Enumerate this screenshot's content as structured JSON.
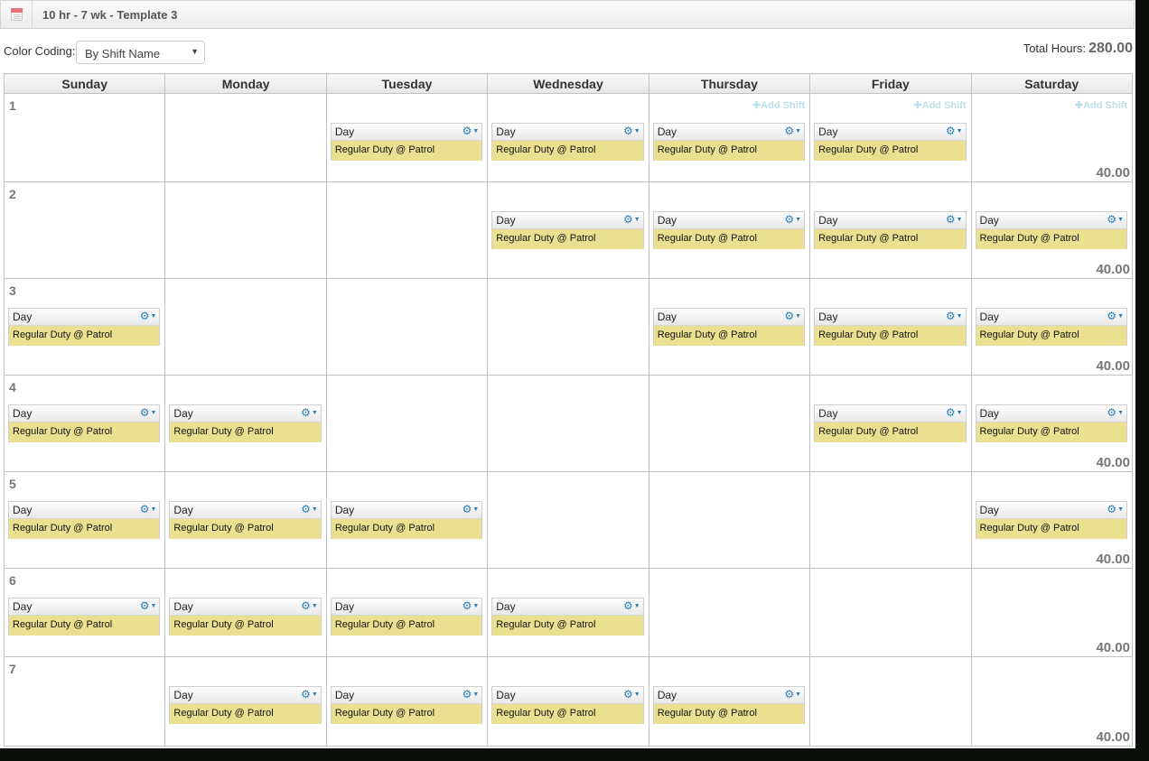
{
  "header": {
    "title": "10 hr - 7 wk - Template 3",
    "icon": "calendar-icon"
  },
  "toolbar": {
    "color_coding_label": "Color Coding:",
    "color_coding_value": "By Shift Name",
    "total_hours_label": "Total Hours:",
    "total_hours_value": "280.00"
  },
  "days": [
    "Sunday",
    "Monday",
    "Tuesday",
    "Wednesday",
    "Thursday",
    "Friday",
    "Saturday"
  ],
  "add_shift_label": "Add Shift",
  "shift_template": {
    "name": "Day",
    "desc": "Regular Duty @ Patrol",
    "color": "#ebe08f"
  },
  "weeks": [
    {
      "num": "1",
      "hours": "40.00",
      "shifts": [
        0,
        0,
        1,
        1,
        1,
        1,
        0
      ],
      "add_shift": [
        0,
        0,
        0,
        0,
        1,
        1,
        1
      ]
    },
    {
      "num": "2",
      "hours": "40.00",
      "shifts": [
        0,
        0,
        0,
        1,
        1,
        1,
        1
      ],
      "add_shift": [
        0,
        0,
        0,
        0,
        0,
        0,
        0
      ]
    },
    {
      "num": "3",
      "hours": "40.00",
      "shifts": [
        1,
        0,
        0,
        0,
        1,
        1,
        1
      ],
      "add_shift": [
        0,
        0,
        0,
        0,
        0,
        0,
        0
      ]
    },
    {
      "num": "4",
      "hours": "40.00",
      "shifts": [
        1,
        1,
        0,
        0,
        0,
        1,
        1
      ],
      "add_shift": [
        0,
        0,
        0,
        0,
        0,
        0,
        0
      ]
    },
    {
      "num": "5",
      "hours": "40.00",
      "shifts": [
        1,
        1,
        1,
        0,
        0,
        0,
        1
      ],
      "add_shift": [
        0,
        0,
        0,
        0,
        0,
        0,
        0
      ]
    },
    {
      "num": "6",
      "hours": "40.00",
      "shifts": [
        1,
        1,
        1,
        1,
        0,
        0,
        0
      ],
      "add_shift": [
        0,
        0,
        0,
        0,
        0,
        0,
        0
      ]
    },
    {
      "num": "7",
      "hours": "40.00",
      "shifts": [
        0,
        1,
        1,
        1,
        1,
        0,
        0
      ],
      "add_shift": [
        0,
        0,
        0,
        0,
        0,
        0,
        0
      ]
    }
  ]
}
